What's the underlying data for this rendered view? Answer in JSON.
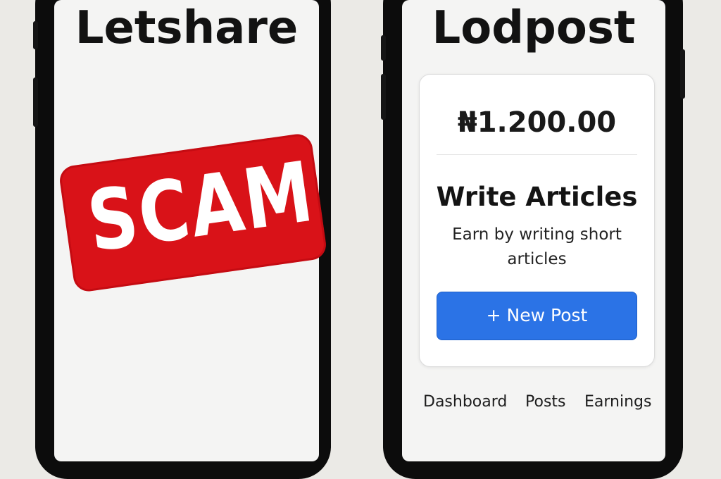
{
  "left_phone": {
    "title": "Letshare",
    "stamp_text": "SCAM",
    "stamp_color": "#d91218"
  },
  "right_phone": {
    "title": "Lodpost",
    "balance": "₦1.200.00",
    "card": {
      "heading": "Write Articles",
      "description": "Earn by writing short articles",
      "button_label": "+ New Post",
      "button_color": "#2b73e6"
    },
    "nav": {
      "items": [
        "Dashboard",
        "Posts",
        "Earnings"
      ]
    }
  }
}
